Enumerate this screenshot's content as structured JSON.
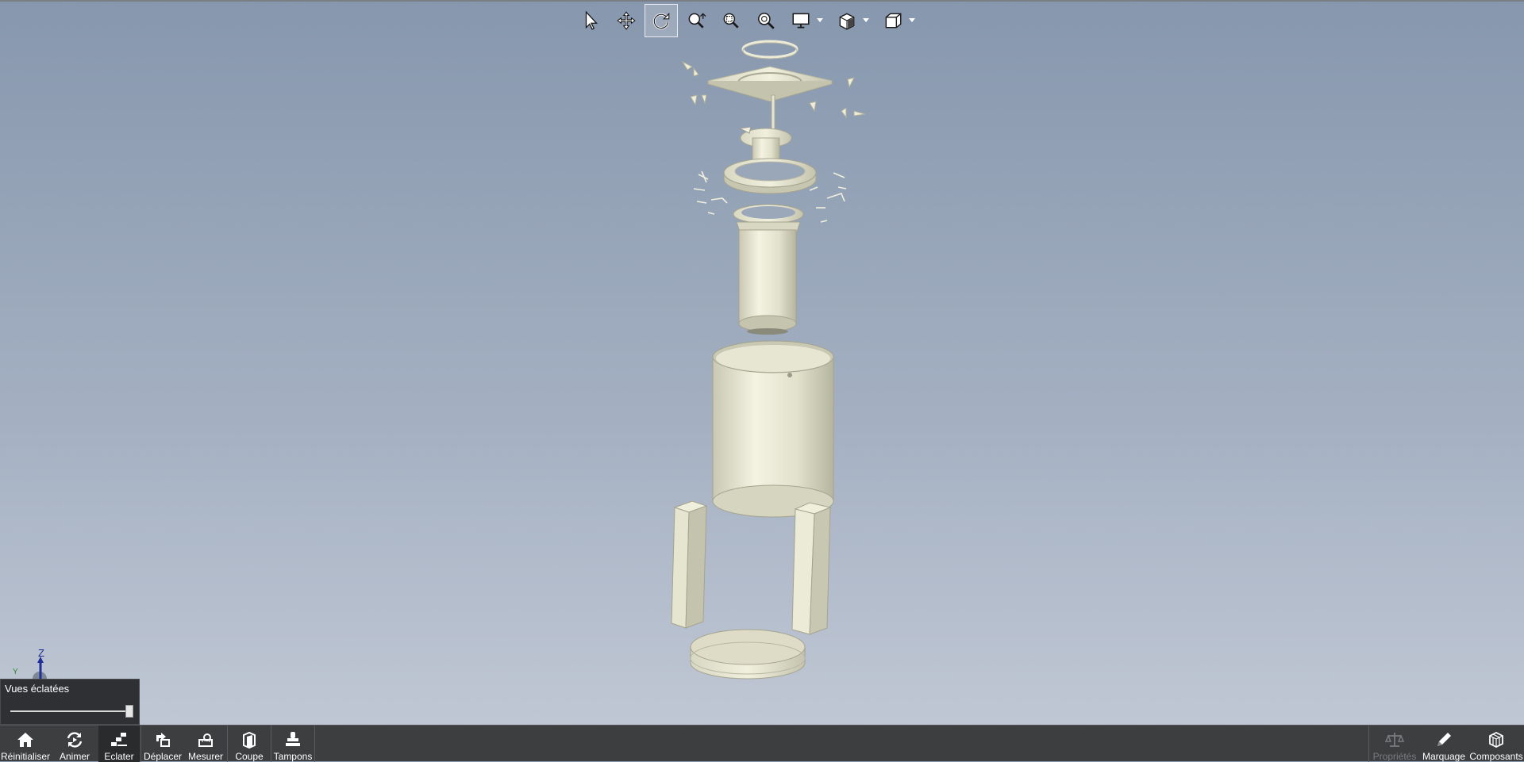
{
  "toolbar_top": {
    "tools": [
      {
        "icon": "arrow-select-icon",
        "active": false
      },
      {
        "icon": "move-pan-icon",
        "active": false
      },
      {
        "icon": "rotate-icon",
        "active": true
      },
      {
        "icon": "zoom-icon",
        "active": false
      },
      {
        "icon": "zoom-window-icon",
        "active": false
      },
      {
        "icon": "zoom-fit-icon",
        "active": false
      },
      {
        "icon": "display-mode-icon",
        "active": false
      },
      {
        "icon": "render-style-icon",
        "active": false
      },
      {
        "icon": "view-cube-icon",
        "active": false
      }
    ]
  },
  "triad": {
    "z_label": "Z",
    "y_label": "Y"
  },
  "explode_panel": {
    "title": "Vues éclatées",
    "level": 1.0
  },
  "bottom_toolbar": {
    "left": [
      {
        "label": "Réinitialiser",
        "icon": "home-icon"
      },
      {
        "label": "Animer",
        "icon": "animate-icon"
      },
      {
        "label": "Eclater",
        "icon": "explode-icon",
        "active": true
      },
      {
        "label": "Déplacer",
        "icon": "move-part-icon"
      },
      {
        "label": "Mesurer",
        "icon": "measure-icon"
      },
      {
        "label": "Coupe",
        "icon": "section-icon"
      },
      {
        "label": "Tampons",
        "icon": "stamp-icon"
      }
    ],
    "right": [
      {
        "label": "Propriétés",
        "icon": "scale-icon",
        "disabled": true
      },
      {
        "label": "Marquage",
        "icon": "pencil-icon"
      },
      {
        "label": "Composants",
        "icon": "components-icon"
      }
    ]
  },
  "colors": {
    "viewport_top": "#8797ad",
    "viewport_bottom": "#c3cad6",
    "part": "#e9e8d4",
    "bar": "#3d3e40"
  }
}
